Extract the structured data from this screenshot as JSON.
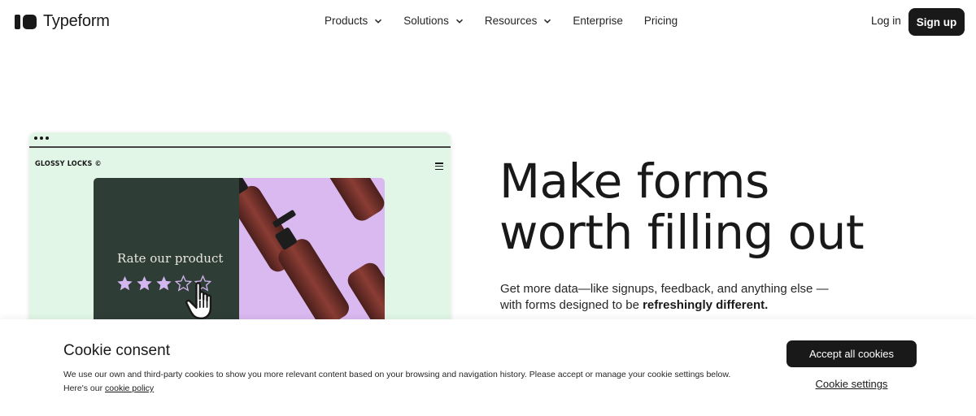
{
  "nav": {
    "logo_text": "Typeform",
    "menu": [
      {
        "label": "Products",
        "has_dropdown": true
      },
      {
        "label": "Solutions",
        "has_dropdown": true
      },
      {
        "label": "Resources",
        "has_dropdown": true
      },
      {
        "label": "Enterprise",
        "has_dropdown": false
      },
      {
        "label": "Pricing",
        "has_dropdown": false
      }
    ],
    "login_label": "Log in",
    "signup_label": "Sign up"
  },
  "preview": {
    "brand": "GLOSSY LOCKS ©",
    "question": "Rate our product",
    "rating": 3,
    "max_rating": 5,
    "colors": {
      "card_bg": "#e1f6e6",
      "form_bg": "#2e3e36",
      "image_bg": "#dab8f0",
      "star_filled": "#d3b6ef",
      "star_empty": "#2e3e36"
    }
  },
  "hero": {
    "headline_line1": "Make forms",
    "headline_line2": "worth filling out",
    "sub_text": "Get more data—like signups, feedback, and anything else —with forms designed to be ",
    "sub_bold": "refreshingly different."
  },
  "cookie": {
    "title": "Cookie consent",
    "text": "We use our own and third-party cookies to show you more relevant content based on your browsing and navigation history. Please accept or manage your cookie settings below. Here's our ",
    "policy_link": "cookie policy",
    "accept_label": "Accept all cookies",
    "settings_label": "Cookie settings"
  }
}
